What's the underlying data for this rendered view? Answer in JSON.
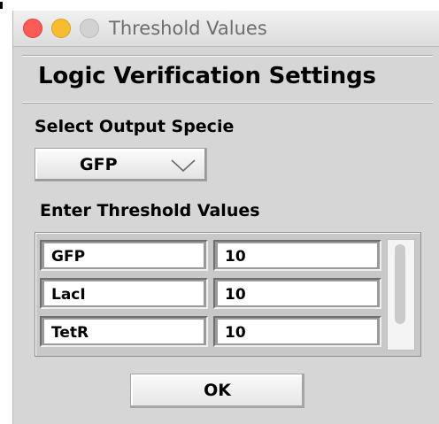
{
  "window": {
    "title": "Threshold Values"
  },
  "header": {
    "title": "Logic Verification Settings"
  },
  "output_specie": {
    "label": "Select Output Specie",
    "selected": "GFP",
    "icon": "chevron-down-icon"
  },
  "thresholds": {
    "label": "Enter Threshold Values",
    "rows": [
      {
        "name": "GFP",
        "value": "10"
      },
      {
        "name": "LacI",
        "value": "10"
      },
      {
        "name": "TetR",
        "value": "10"
      }
    ]
  },
  "actions": {
    "ok_label": "OK"
  },
  "colors": {
    "close": "#fc5b57",
    "minimize": "#f5bd2f",
    "zoom_disabled": "#d2d2d2",
    "window_bg": "#d6d6d6"
  }
}
